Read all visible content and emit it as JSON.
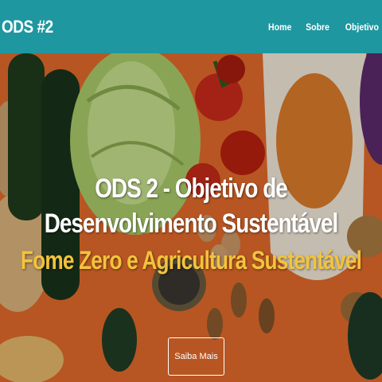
{
  "navbar": {
    "brand": "ODS #2",
    "links": [
      {
        "label": "Home"
      },
      {
        "label": "Sobre"
      },
      {
        "label": "Objetivo"
      }
    ],
    "background_color": "#1e97a0"
  },
  "hero": {
    "title": "ODS 2 - Objetivo de Desenvolvimento Sustentável",
    "subtitle": "Fome Zero e Agricultura Sustentável",
    "subtitle_color": "#f3c33c",
    "button_label": "Saiba Mais",
    "background_color": "#e06a2a"
  }
}
